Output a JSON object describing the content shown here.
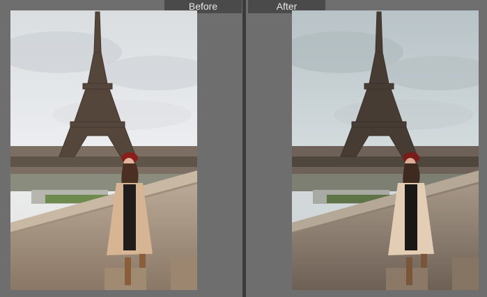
{
  "compare": {
    "before_label": "Before",
    "after_label": "After"
  },
  "colors": {
    "background": "#6e6e6e",
    "divider": "#3a3a3a",
    "label_tab": "#4a4a4a",
    "label_text": "#e8e8e8"
  },
  "photos": {
    "before": {
      "subject": "eiffel-tower-portrait-original",
      "tone": "warm"
    },
    "after": {
      "subject": "eiffel-tower-portrait-edited",
      "tone": "cool-faded"
    }
  }
}
